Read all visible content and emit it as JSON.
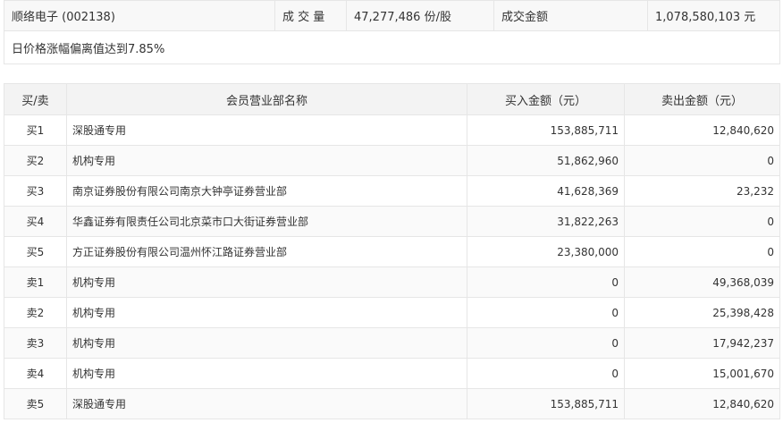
{
  "summary": {
    "stock": "顺络电子 (002138)",
    "volume_label": "成 交 量",
    "volume_value": "47,277,486 份/股",
    "turnover_label": "成交金额",
    "turnover_value": "1,078,580,103 元",
    "reason": "日价格涨幅偏离值达到7.85%"
  },
  "table": {
    "headers": [
      "买/卖",
      "会员营业部名称",
      "买入金额（元）",
      "卖出金额（元）"
    ],
    "rows": [
      {
        "side": "买1",
        "name": "深股通专用",
        "buy": "153,885,711",
        "sell": "12,840,620"
      },
      {
        "side": "买2",
        "name": "机构专用",
        "buy": "51,862,960",
        "sell": "0"
      },
      {
        "side": "买3",
        "name": "南京证券股份有限公司南京大钟亭证券营业部",
        "buy": "41,628,369",
        "sell": "23,232"
      },
      {
        "side": "买4",
        "name": "华鑫证券有限责任公司北京菜市口大街证券营业部",
        "buy": "31,822,263",
        "sell": "0"
      },
      {
        "side": "买5",
        "name": "方正证券股份有限公司温州怀江路证券营业部",
        "buy": "23,380,000",
        "sell": "0"
      },
      {
        "side": "卖1",
        "name": "机构专用",
        "buy": "0",
        "sell": "49,368,039"
      },
      {
        "side": "卖2",
        "name": "机构专用",
        "buy": "0",
        "sell": "25,398,428"
      },
      {
        "side": "卖3",
        "name": "机构专用",
        "buy": "0",
        "sell": "17,942,237"
      },
      {
        "side": "卖4",
        "name": "机构专用",
        "buy": "0",
        "sell": "15,001,670"
      },
      {
        "side": "卖5",
        "name": "深股通专用",
        "buy": "153,885,711",
        "sell": "12,840,620"
      }
    ]
  }
}
